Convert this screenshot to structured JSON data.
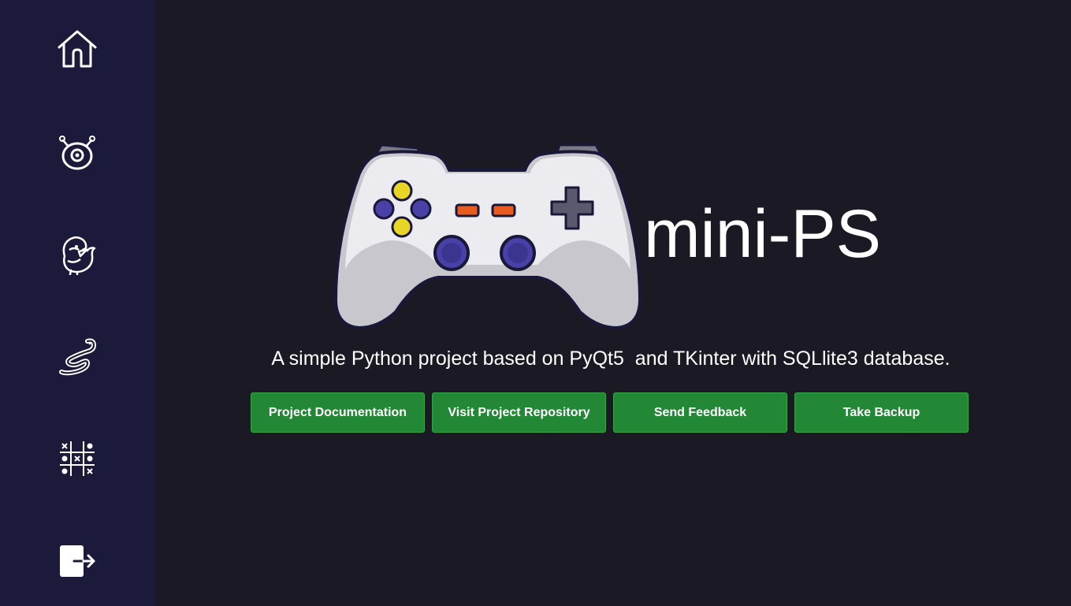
{
  "sidebar": {
    "items": [
      {
        "name": "home",
        "icon": "home-icon"
      },
      {
        "name": "alien",
        "icon": "alien-icon"
      },
      {
        "name": "flappy-bird",
        "icon": "bird-icon"
      },
      {
        "name": "snake",
        "icon": "snake-icon"
      },
      {
        "name": "tic-tac-toe",
        "icon": "tic-tac-toe-icon"
      },
      {
        "name": "exit",
        "icon": "exit-icon"
      }
    ]
  },
  "hero": {
    "logo_icon": "game-controller-icon",
    "title": "mini-PS",
    "tagline": "A simple Python project based on PyQt5  and TKinter with SQLlite3 database."
  },
  "actions": {
    "documentation": "Project Documentation",
    "repository": "Visit Project Repository",
    "feedback": "Send Feedback",
    "backup": "Take Backup"
  },
  "colors": {
    "background": "#1b1a24",
    "sidebar": "#1b1a3b",
    "button": "#238836",
    "text": "#ffffff"
  }
}
